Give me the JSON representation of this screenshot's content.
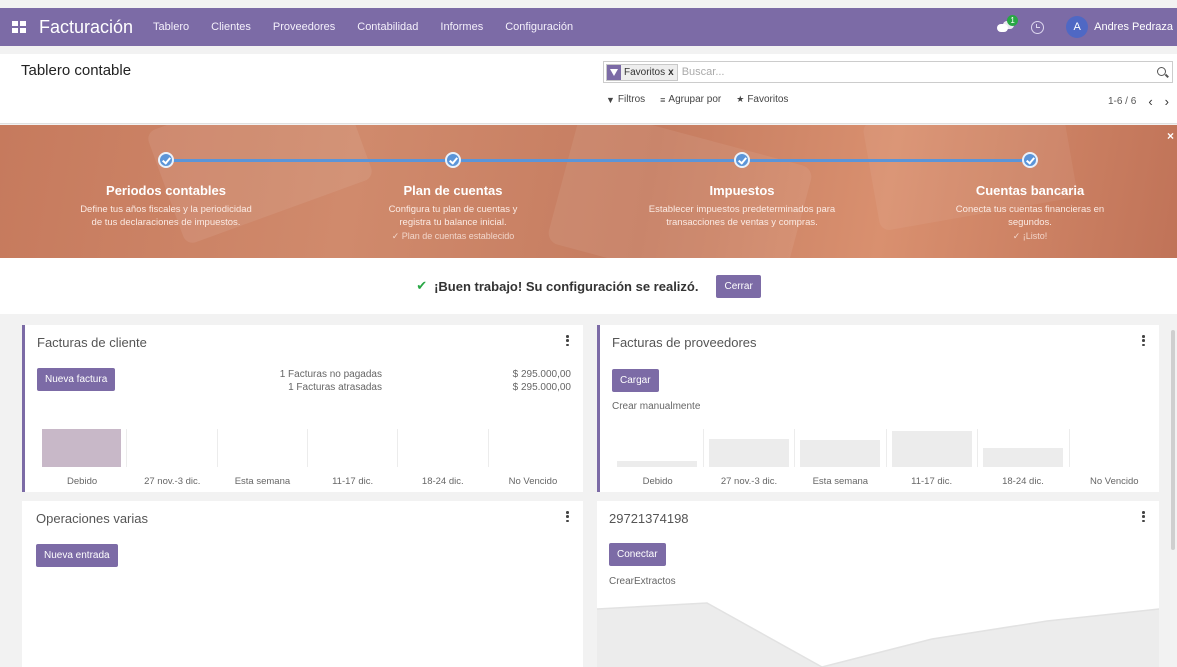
{
  "navbar": {
    "app_name": "Facturación",
    "menu": [
      "Tablero",
      "Clientes",
      "Proveedores",
      "Contabilidad",
      "Informes",
      "Configuración"
    ],
    "chat_badge": "1",
    "user_initial": "A",
    "user_name": "Andres Pedraza",
    "color": "#7c6ba6"
  },
  "control_panel": {
    "title": "Tablero contable",
    "facet_label": "Favoritos",
    "facet_remove": "x",
    "search_placeholder": "Buscar...",
    "filters_label": "Filtros",
    "group_by_label": "Agrupar por",
    "favorites_label": "Favoritos",
    "pager": "1-6 / 6"
  },
  "onboarding": {
    "steps": [
      {
        "title": "Periodos contables",
        "desc": "Define tus años fiscales y la periodicidad de tus declaraciones de impuestos.",
        "link": ""
      },
      {
        "title": "Plan de cuentas",
        "desc": "Configura tu plan de cuentas y registra tu balance inicial.",
        "link": "✓ Plan de cuentas establecido"
      },
      {
        "title": "Impuestos",
        "desc": "Establecer impuestos predeterminados para transacciones de ventas y compras.",
        "link": ""
      },
      {
        "title": "Cuentas bancaria",
        "desc": "Conecta tus cuentas financieras en segundos.",
        "link": "✓ ¡Listo!"
      }
    ],
    "close": "×"
  },
  "success": {
    "message": "¡Buen trabajo! Su configuración se realizó.",
    "close_button": "Cerrar"
  },
  "cards": {
    "customer_invoices": {
      "title": "Facturas de cliente",
      "button": "Nueva factura",
      "stats": [
        {
          "label": "1 Facturas no pagadas",
          "amount": "$ 295.000,00"
        },
        {
          "label": "1 Facturas atrasadas",
          "amount": "$ 295.000,00"
        }
      ],
      "chart_labels": [
        "Debido",
        "27 nov.-3 dic.",
        "Esta semana",
        "11-17 dic.",
        "18-24 dic.",
        "No Vencido"
      ],
      "bar_values": [
        1,
        0,
        0,
        0,
        0,
        0
      ],
      "bar_color": "#c8b8c8"
    },
    "vendor_bills": {
      "title": "Facturas de proveedores",
      "button": "Cargar",
      "sub_link": "Crear manualmente",
      "chart_labels": [
        "Debido",
        "27 nov.-3 dic.",
        "Esta semana",
        "11-17 dic.",
        "18-24 dic.",
        "No Vencido"
      ],
      "bar_values": [
        0.15,
        0.75,
        0.7,
        0.95,
        0.5,
        0
      ],
      "bar_color": "#ececec"
    },
    "misc_operations": {
      "title": "Operaciones varias",
      "button": "Nueva entrada"
    },
    "bank": {
      "title": "29721374198",
      "button": "Conectar",
      "sub_link": "CrearExtractos"
    }
  }
}
